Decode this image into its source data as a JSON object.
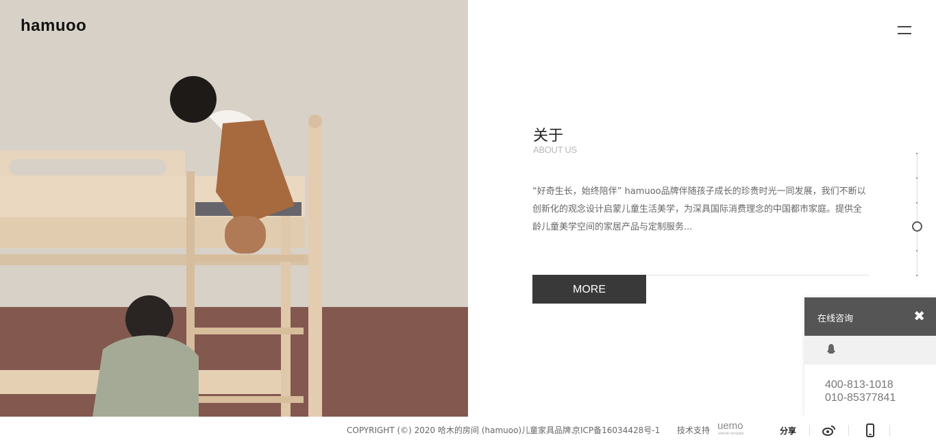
{
  "header": {
    "logo": "hamuoo"
  },
  "about": {
    "title": "关于",
    "subtitle": "ABOUT US",
    "description": "“好奇生长，始终陪伴” hamuoo品牌伴随孩子成长的珍贵时光一同发展，我们不断以创新化的观念设计启蒙儿童生活美学，为深具国际消费理念的中国都市家庭。提供全龄儿童美学空间的家居产品与定制服务...",
    "more_label": "MORE"
  },
  "chat": {
    "title": "在线咨询",
    "close": "✖",
    "phone1": "400-813-1018",
    "phone2": "010-85377841"
  },
  "footer": {
    "copyright": "COPYRIGHT (©) 2020 哈木的房间 (hamuoo)儿童家具品牌.",
    "icp": "京ICP备16034428号-1",
    "tech": "技术支持",
    "uemo": "uemo",
    "uemo_tagline": "website template",
    "share": "分享"
  },
  "icons": {
    "menu": "hamburger-icon",
    "qq": "qq-icon",
    "weibo": "weibo-icon",
    "mobile": "mobile-icon"
  }
}
